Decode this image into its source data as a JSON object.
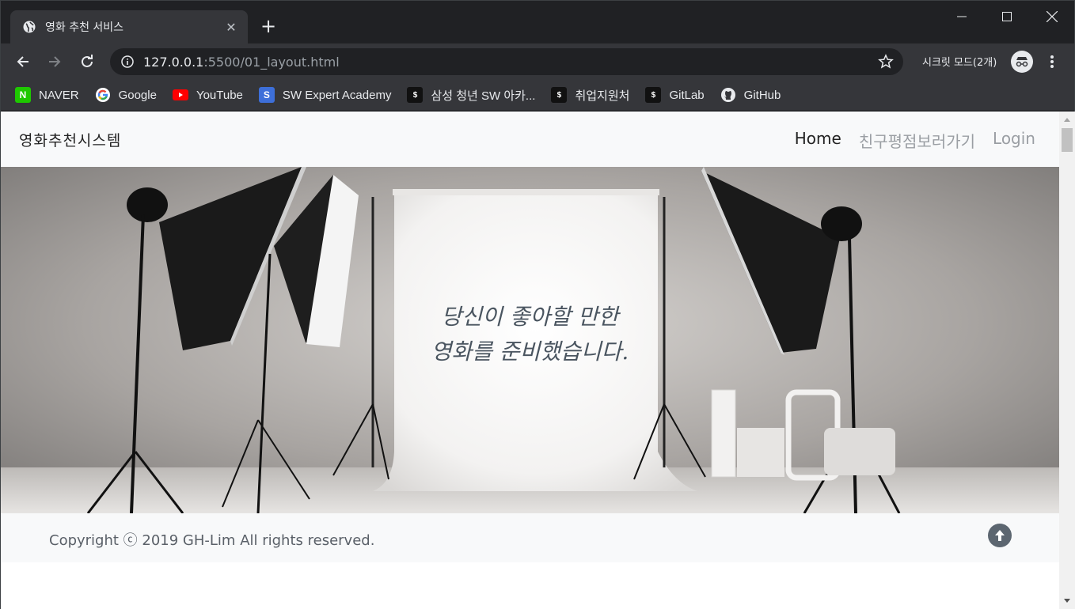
{
  "browser": {
    "tab_title": "영화 추천 서비스",
    "url_host": "127.0.0.1",
    "url_path": ":5500/01_layout.html",
    "incognito_label": "시크릿 모드(2개)",
    "bookmarks": [
      {
        "label": "NAVER",
        "icon": "naver-icon"
      },
      {
        "label": "Google",
        "icon": "google-icon"
      },
      {
        "label": "YouTube",
        "icon": "youtube-icon"
      },
      {
        "label": "SW Expert Academy",
        "icon": "swea-icon"
      },
      {
        "label": "삼성 청년 SW 아카...",
        "icon": "ssafy-icon"
      },
      {
        "label": "취업지원처",
        "icon": "ssafy-icon"
      },
      {
        "label": "GitLab",
        "icon": "ssafy-icon"
      },
      {
        "label": "GitHub",
        "icon": "github-icon"
      }
    ]
  },
  "page": {
    "brand": "영화추천시스템",
    "nav": [
      {
        "label": "Home",
        "active": true
      },
      {
        "label": "친구평점보러가기",
        "active": false
      },
      {
        "label": "Login",
        "active": false
      }
    ],
    "hero_line1": "당신이 좋아할 만한",
    "hero_line2": "영화를 준비했습니다.",
    "footer_text": "Copyright ⓒ 2019 GH-Lim All rights reserved."
  },
  "colors": {
    "chrome_dark": "#202124",
    "chrome_toolbar": "#35363a",
    "navbar_bg": "#f8f9fa",
    "nav_muted": "#9a9ea3",
    "hero_text": "#4a5560",
    "to_top_button": "#5c6670"
  }
}
